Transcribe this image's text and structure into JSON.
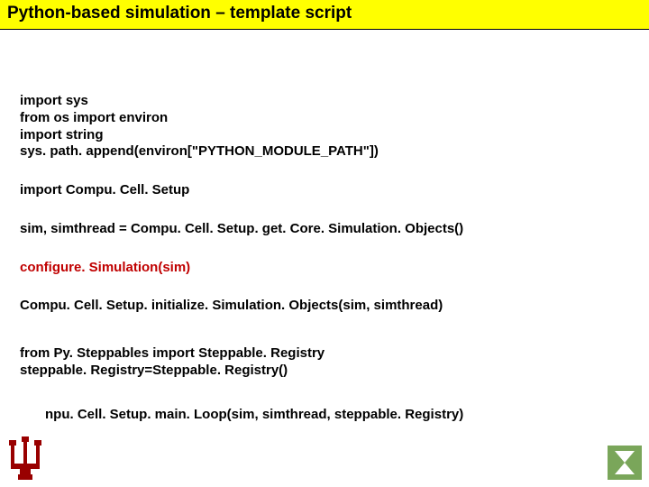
{
  "title": "Python-based simulation – template script",
  "blocks": {
    "b1": {
      "l1": "import sys",
      "l2": "from os import environ",
      "l3": "import string",
      "l4": "sys. path. append(environ[\"PYTHON_MODULE_PATH\"])"
    },
    "b2": {
      "l1": "import Compu. Cell. Setup"
    },
    "b3": {
      "l1": "sim, simthread = Compu. Cell. Setup. get. Core. Simulation. Objects()"
    },
    "b4": {
      "l1": "configure. Simulation(sim)"
    },
    "b5": {
      "l1": "Compu. Cell. Setup. initialize. Simulation. Objects(sim, simthread)"
    },
    "b6": {
      "l1": "from Py. Steppables import Steppable. Registry",
      "l2": "steppable. Registry=Steppable. Registry()"
    },
    "b7": {
      "l1": "npu. Cell. Setup. main. Loop(sim, simthread, steppable. Registry)"
    }
  }
}
